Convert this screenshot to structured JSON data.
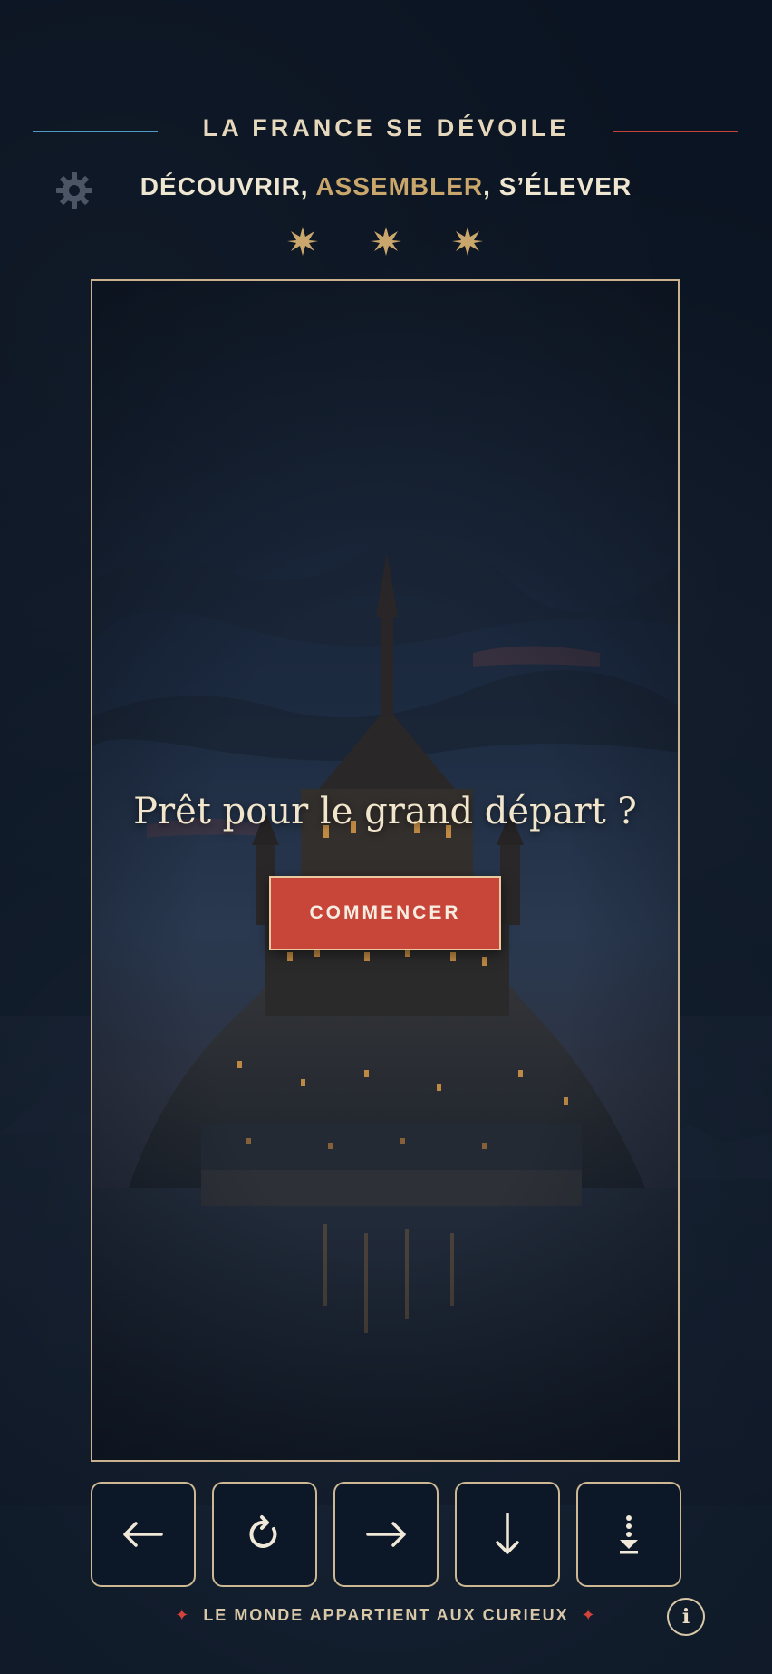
{
  "header": {
    "title": "LA FRANCE SE DÉVOILE",
    "subtitle_part1": "DÉCOUVRIR, ",
    "subtitle_accent": "ASSEMBLER",
    "subtitle_part2": ", S’ÉLEVER",
    "stars_count": 3
  },
  "board": {
    "prompt": "Prêt pour le grand départ ?",
    "start_label": "COMMENCER",
    "scene": "mont-saint-michel-night"
  },
  "controls": [
    {
      "name": "move-left-button",
      "icon": "arrow-left-icon"
    },
    {
      "name": "rotate-button",
      "icon": "rotate-icon"
    },
    {
      "name": "move-right-button",
      "icon": "arrow-right-icon"
    },
    {
      "name": "soft-drop-button",
      "icon": "arrow-down-icon"
    },
    {
      "name": "hard-drop-button",
      "icon": "hard-drop-icon"
    }
  ],
  "footer": {
    "tagline": "LE MONDE APPARTIENT AUX CURIEUX",
    "info_label": "i"
  },
  "colors": {
    "background": "#0d1726",
    "gold": "#c9a66b",
    "frame": "#c9b28d",
    "accent_red": "#c8453a",
    "line_blue": "#4f9ac2",
    "line_red": "#c5413a"
  }
}
